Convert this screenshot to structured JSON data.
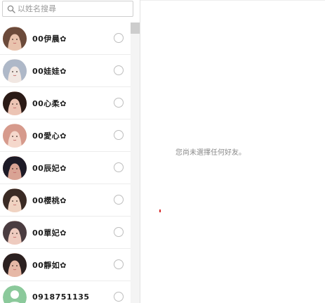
{
  "search": {
    "placeholder": "以姓名搜尋",
    "icon": "search-icon"
  },
  "contacts": [
    {
      "name": "00伊晨✿",
      "avatar_colors": [
        "#6b4a3a",
        "#e9c3ad"
      ]
    },
    {
      "name": "00娃娃✿",
      "avatar_colors": [
        "#aeb8c8",
        "#f1e7e2"
      ]
    },
    {
      "name": "00心柔✿",
      "avatar_colors": [
        "#2a1a16",
        "#ecc4b4"
      ]
    },
    {
      "name": "00愛心✿",
      "avatar_colors": [
        "#d69a8c",
        "#f5d8cc"
      ]
    },
    {
      "name": "00辰妃✿",
      "avatar_colors": [
        "#1d1a26",
        "#d9a394"
      ]
    },
    {
      "name": "00櫻桃✿",
      "avatar_colors": [
        "#3a2a24",
        "#f0d3c2"
      ]
    },
    {
      "name": "00單妃✿",
      "avatar_colors": [
        "#4a3c40",
        "#eecbbf"
      ]
    },
    {
      "name": "00靜如✿",
      "avatar_colors": [
        "#2b2020",
        "#e6b8a6"
      ]
    },
    {
      "name": "0918751135",
      "avatar_colors": [
        "#8bc99b",
        "#ffffff"
      ]
    }
  ],
  "empty_message": "您尚未選擇任何好友。",
  "colors": {
    "divider": "#e2e2e2",
    "row_border": "#ececec",
    "radio_border": "#bdbdbd",
    "default_avatar": "#8bc99b"
  }
}
